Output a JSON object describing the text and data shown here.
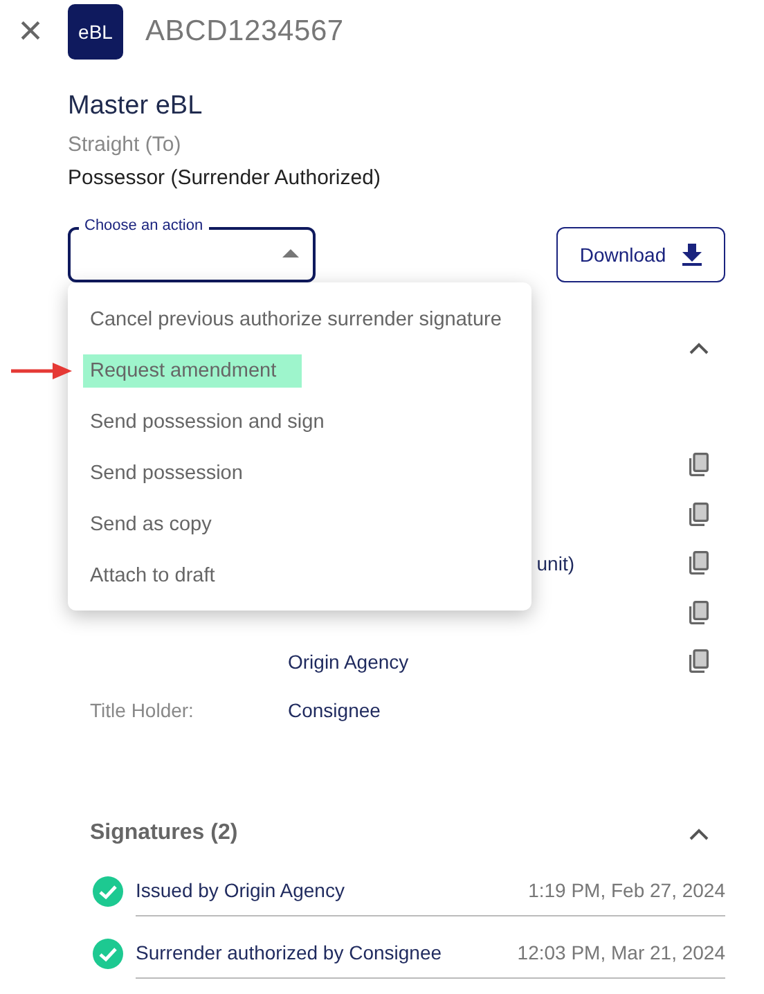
{
  "header": {
    "close": "×",
    "logo": "eBL",
    "document_number": "ABCD1234567"
  },
  "title": "Master eBL",
  "type": "Straight (To)",
  "status": "Possessor (Surrender Authorized)",
  "action_select": {
    "label": "Choose an action",
    "expanded": true
  },
  "download_button": "Download",
  "details": {
    "expanded": true,
    "rows": [
      {
        "kind": "blank",
        "label": "",
        "value": "",
        "copy": true
      },
      {
        "kind": "blank",
        "label": "",
        "value": "",
        "copy": true
      },
      {
        "kind": "cut",
        "label": "",
        "value": "unit)",
        "copy": true
      },
      {
        "kind": "blank",
        "label": "",
        "value": "",
        "copy": true
      },
      {
        "kind": "full",
        "label": "",
        "value": "Origin Agency",
        "copy": true
      },
      {
        "kind": "full",
        "label": "Title Holder:",
        "value": "Consignee",
        "copy": false
      }
    ]
  },
  "signatures": {
    "title": "Signatures (2)",
    "expanded": true,
    "items": [
      {
        "text": "Issued by Origin Agency",
        "time": "1:19 PM, Feb 27, 2024",
        "done": true
      },
      {
        "text": "Surrender authorized by Consignee",
        "time": "12:03 PM, Mar 21, 2024",
        "done": true
      }
    ]
  },
  "menu": {
    "items": [
      {
        "label": "Cancel previous authorize surrender signature",
        "selected": false
      },
      {
        "label": "Request amendment",
        "selected": true
      },
      {
        "label": "Send possession and sign",
        "selected": false
      },
      {
        "label": "Send possession",
        "selected": false
      },
      {
        "label": "Send as copy",
        "selected": false
      },
      {
        "label": "Attach to draft",
        "selected": false
      }
    ]
  }
}
